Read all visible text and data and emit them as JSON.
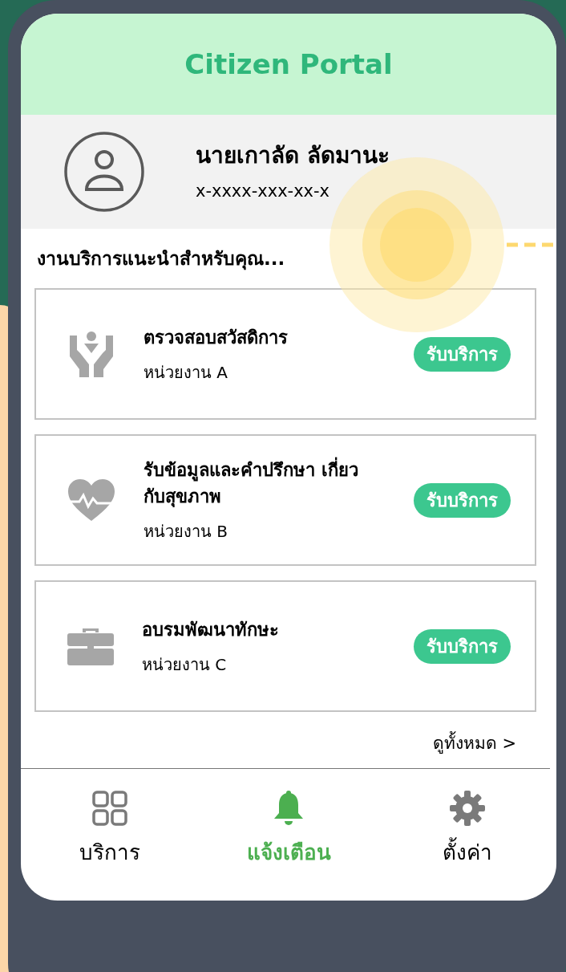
{
  "app_title": "Citizen Portal",
  "profile": {
    "name": "นายเกาลัด ลัดมานะ",
    "id_number": "x-xxxx-xxx-xx-x"
  },
  "section_title": "งานบริการแนะนำสำหรับคุณ...",
  "services": [
    {
      "title": "ตรวจสอบสวัสดิการ",
      "agency": "หน่วยงาน A",
      "button": "รับบริการ"
    },
    {
      "title": "รับข้อมูลและคำปรึกษา เกี่ยวกับสุขภาพ",
      "agency": "หน่วยงาน B",
      "button": "รับบริการ"
    },
    {
      "title": "อบรมพัฒนาทักษะ",
      "agency": "หน่วยงาน C",
      "button": "รับบริการ"
    }
  ],
  "view_all": "ดูทั้งหมด >",
  "nav": [
    {
      "label": "บริการ",
      "selected": false
    },
    {
      "label": "แจ้งเตือน",
      "selected": true
    },
    {
      "label": "ตั้งค่า",
      "selected": false
    }
  ]
}
